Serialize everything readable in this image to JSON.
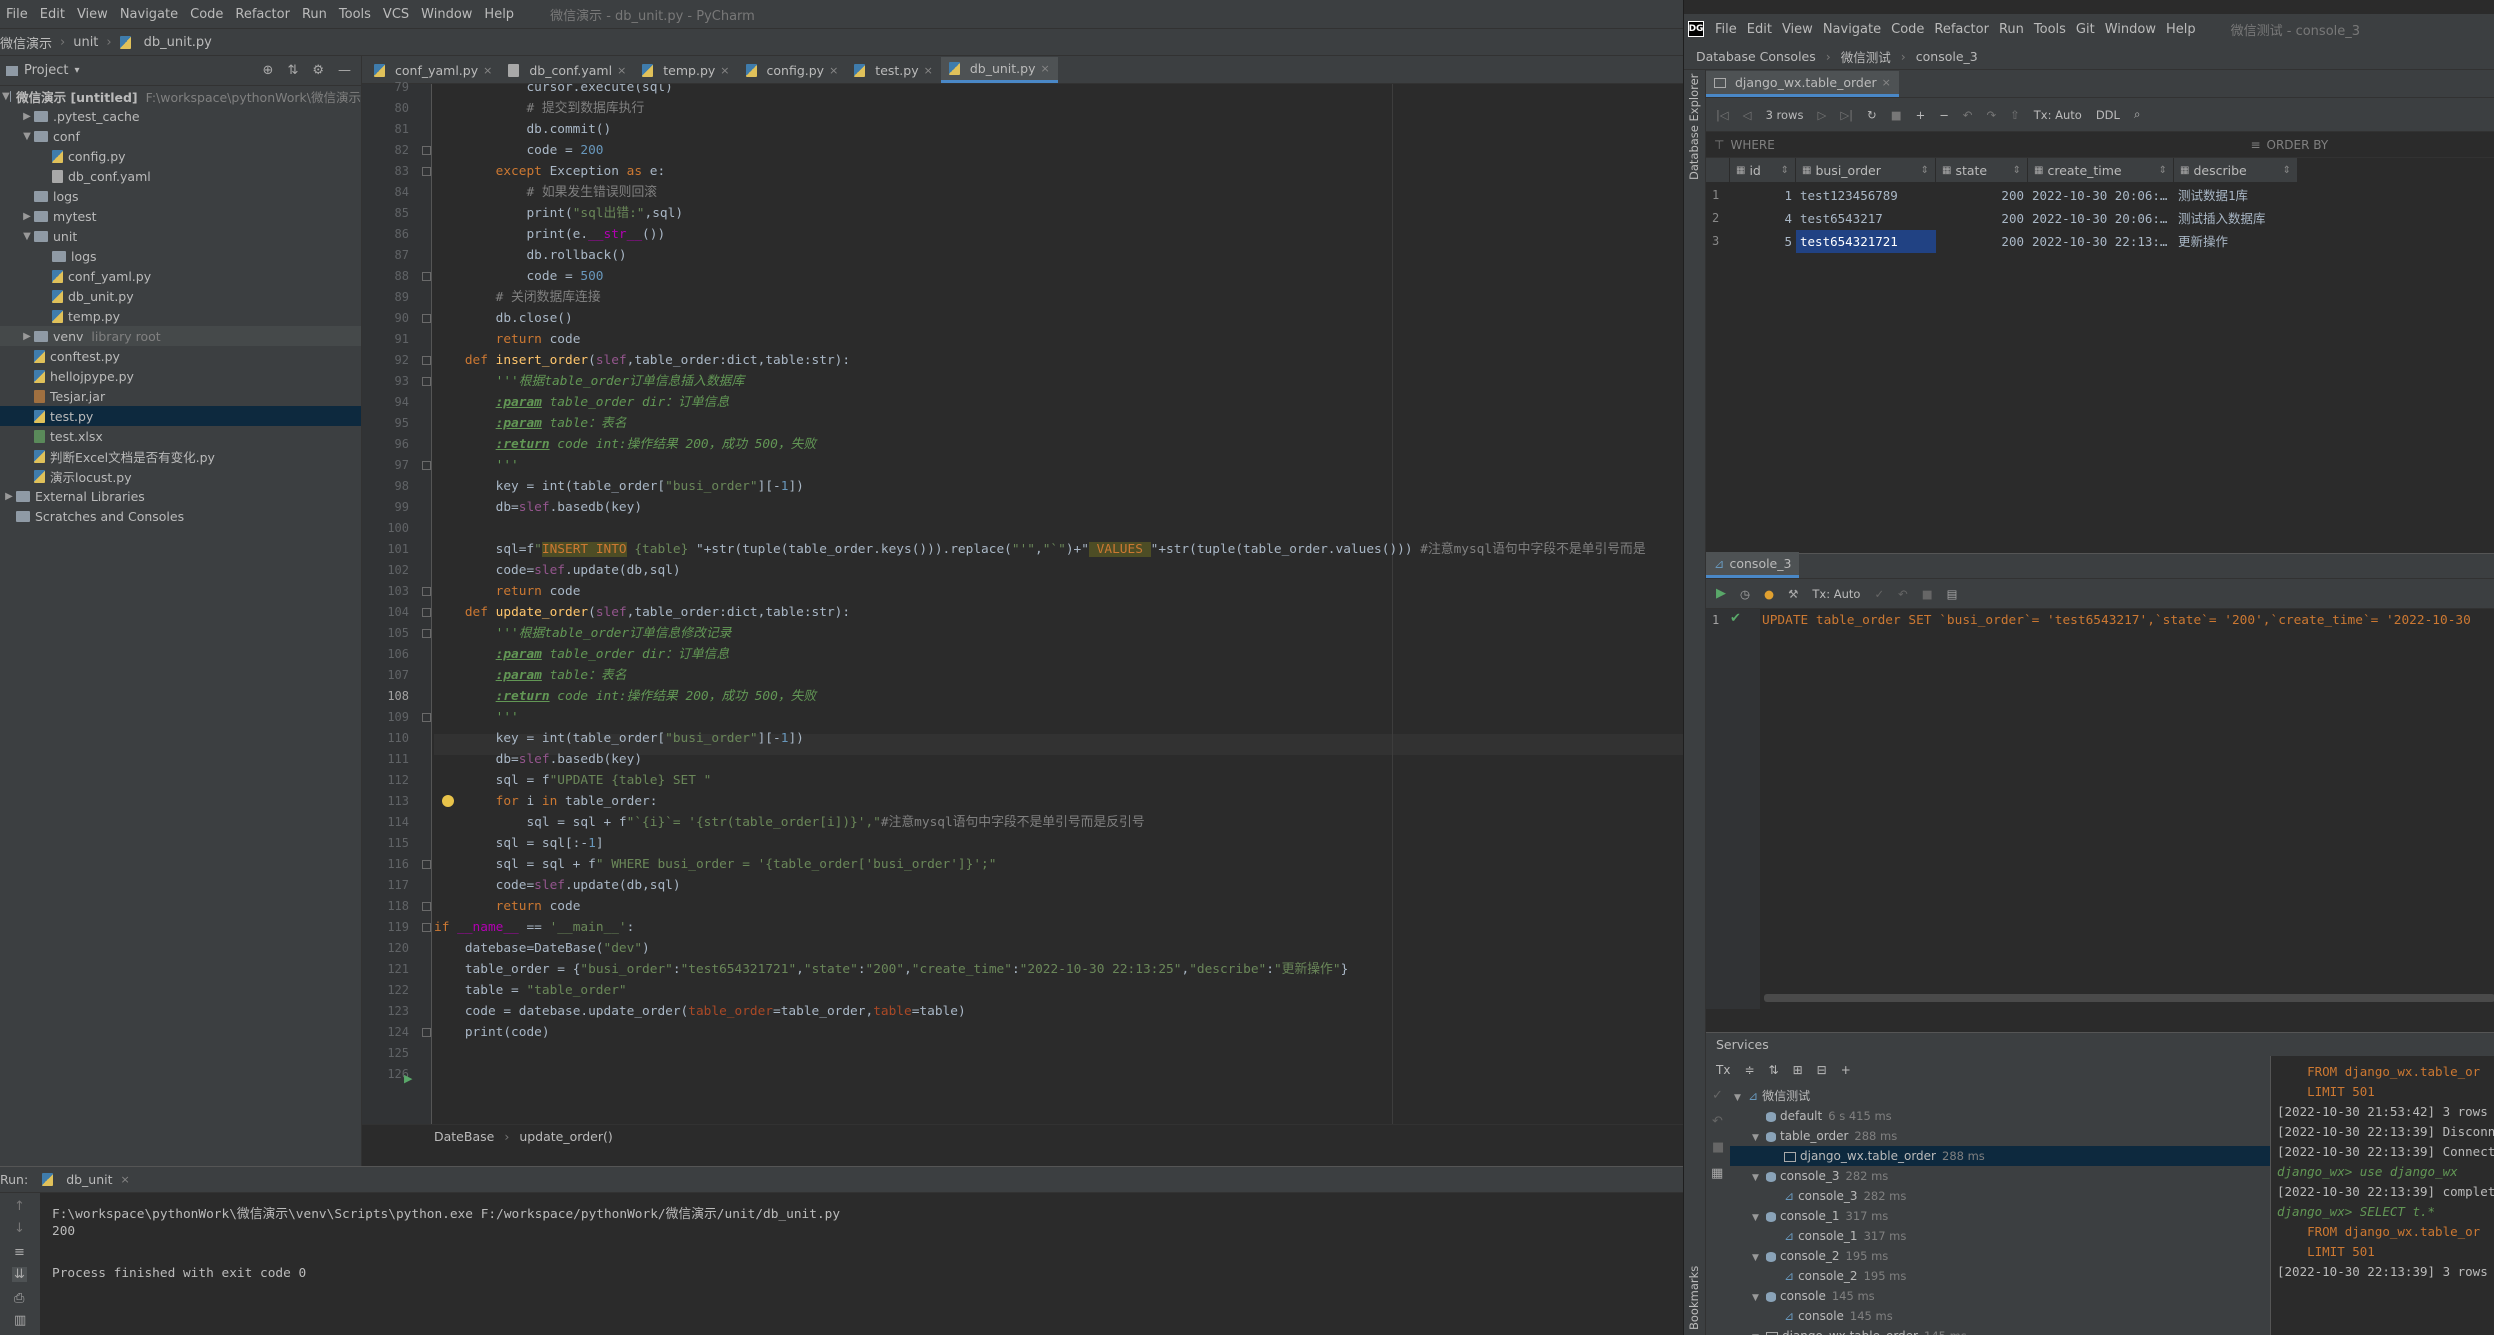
{
  "left": {
    "menu": [
      "File",
      "Edit",
      "View",
      "Navigate",
      "Code",
      "Refactor",
      "Run",
      "Tools",
      "VCS",
      "Window",
      "Help"
    ],
    "window_title": "微信演示 - db_unit.py - PyCharm",
    "breadcrumb": [
      "微信演示",
      "unit",
      "db_unit.py"
    ],
    "project_label": "Project",
    "tree": [
      {
        "name": "微信演示 [untitled]",
        "extra": "F:\\workspace\\pythonWork\\微信演示",
        "type": "root",
        "depth": 0,
        "arrow": "▼"
      },
      {
        "name": ".pytest_cache",
        "type": "folder",
        "depth": 1,
        "arrow": "▶"
      },
      {
        "name": "conf",
        "type": "folder",
        "depth": 1,
        "arrow": "▼"
      },
      {
        "name": "config.py",
        "type": "py",
        "depth": 2,
        "arrow": ""
      },
      {
        "name": "db_conf.yaml",
        "type": "yaml",
        "depth": 2,
        "arrow": ""
      },
      {
        "name": "logs",
        "type": "folder",
        "depth": 1,
        "arrow": ""
      },
      {
        "name": "mytest",
        "type": "folder",
        "depth": 1,
        "arrow": "▶"
      },
      {
        "name": "unit",
        "type": "folder",
        "depth": 1,
        "arrow": "▼"
      },
      {
        "name": "logs",
        "type": "folder",
        "depth": 2,
        "arrow": ""
      },
      {
        "name": "conf_yaml.py",
        "type": "py",
        "depth": 2,
        "arrow": ""
      },
      {
        "name": "db_unit.py",
        "type": "py",
        "depth": 2,
        "arrow": ""
      },
      {
        "name": "temp.py",
        "type": "py",
        "depth": 2,
        "arrow": ""
      },
      {
        "name": "venv",
        "extra": "library root",
        "type": "folder",
        "depth": 1,
        "arrow": "▶",
        "hl": true
      },
      {
        "name": "conftest.py",
        "type": "py",
        "depth": 1,
        "arrow": ""
      },
      {
        "name": "hellojpype.py",
        "type": "py",
        "depth": 1,
        "arrow": ""
      },
      {
        "name": "Tesjar.jar",
        "type": "jar",
        "depth": 1,
        "arrow": ""
      },
      {
        "name": "test.py",
        "type": "py",
        "depth": 1,
        "arrow": "",
        "sel": true
      },
      {
        "name": "test.xlsx",
        "type": "xlsx",
        "depth": 1,
        "arrow": ""
      },
      {
        "name": "判断Excel文档是否有变化.py",
        "type": "py",
        "depth": 1,
        "arrow": ""
      },
      {
        "name": "演示locust.py",
        "type": "py",
        "depth": 1,
        "arrow": ""
      },
      {
        "name": "External Libraries",
        "type": "folder",
        "depth": 0,
        "arrow": "▶"
      },
      {
        "name": "Scratches and Consoles",
        "type": "folder",
        "depth": 0,
        "arrow": ""
      }
    ],
    "tabs": [
      "conf_yaml.py",
      "db_conf.yaml",
      "temp.py",
      "config.py",
      "test.py",
      "db_unit.py"
    ],
    "active_tab": "db_unit.py",
    "first_line": 79,
    "code_crumb": [
      "DateBase",
      "update_order()"
    ],
    "run_tab": "db_unit",
    "run_label": "Run:",
    "run_output": [
      "F:\\workspace\\pythonWork\\微信演示\\venv\\Scripts\\python.exe F:/workspace/pythonWork/微信演示/unit/db_unit.py",
      "200",
      "",
      "Process finished with exit code 0"
    ]
  },
  "right": {
    "menu": [
      "File",
      "Edit",
      "View",
      "Navigate",
      "Code",
      "Refactor",
      "Run",
      "Tools",
      "Git",
      "Window",
      "Help"
    ],
    "window_title": "微信测试 - console_3",
    "nav": [
      "Database Consoles",
      "微信测试",
      "console_3"
    ],
    "side_label": "Database Explorer",
    "bookmarks_label": "Bookmarks",
    "table_tab": "django_wx.table_order",
    "rows_label": "3 rows",
    "tx_label": "Tx: Auto",
    "ddl_label": "DDL",
    "where_label": "WHERE",
    "orderby_label": "ORDER BY",
    "columns": [
      "id",
      "busi_order",
      "state",
      "create_time",
      "describe"
    ],
    "rows": [
      {
        "n": "1",
        "id": "1",
        "busi_order": "test123456789",
        "state": "200",
        "create_time": "2022-10-30 20:06:…",
        "describe": "测试数据1库"
      },
      {
        "n": "2",
        "id": "4",
        "busi_order": "test6543217",
        "state": "200",
        "create_time": "2022-10-30 20:06:…",
        "describe": "测试插入数据库"
      },
      {
        "n": "3",
        "id": "5",
        "busi_order": "test654321721",
        "state": "200",
        "create_time": "2022-10-30 22:13:…",
        "describe": "更新操作"
      }
    ],
    "console_tab": "console_3",
    "console_line_no": "1",
    "console_sql": "UPDATE table_order SET `busi_order`= 'test6543217',`state`= '200',`create_time`= '2022-10-30",
    "services_label": "Services",
    "tx_short": "Tx",
    "services": [
      {
        "name": "微信测试",
        "ms": "",
        "depth": 0,
        "kind": "ds",
        "arrow": "▼"
      },
      {
        "name": "default",
        "ms": "6 s 415 ms",
        "depth": 1,
        "kind": "db",
        "arrow": ""
      },
      {
        "name": "table_order",
        "ms": "288 ms",
        "depth": 1,
        "kind": "db",
        "arrow": "▼"
      },
      {
        "name": "django_wx.table_order",
        "ms": "288 ms",
        "depth": 2,
        "kind": "tbl",
        "arrow": "",
        "sel": true
      },
      {
        "name": "console_3",
        "ms": "282 ms",
        "depth": 1,
        "kind": "db",
        "arrow": "▼"
      },
      {
        "name": "console_3",
        "ms": "282 ms",
        "depth": 2,
        "kind": "con",
        "arrow": ""
      },
      {
        "name": "console_1",
        "ms": "317 ms",
        "depth": 1,
        "kind": "db",
        "arrow": "▼"
      },
      {
        "name": "console_1",
        "ms": "317 ms",
        "depth": 2,
        "kind": "con",
        "arrow": ""
      },
      {
        "name": "console_2",
        "ms": "195 ms",
        "depth": 1,
        "kind": "db",
        "arrow": "▼"
      },
      {
        "name": "console_2",
        "ms": "195 ms",
        "depth": 2,
        "kind": "con",
        "arrow": ""
      },
      {
        "name": "console",
        "ms": "145 ms",
        "depth": 1,
        "kind": "db",
        "arrow": "▼"
      },
      {
        "name": "console",
        "ms": "145 ms",
        "depth": 2,
        "kind": "con",
        "arrow": ""
      },
      {
        "name": "django_wx.table_order",
        "ms": "145 ms",
        "depth": 1,
        "kind": "tbl",
        "arrow": "▼"
      }
    ],
    "log": [
      {
        "t": "    FROM django_wx.table_or",
        "k": "k"
      },
      {
        "t": "    LIMIT 501",
        "k": "k"
      },
      {
        "t": "[2022-10-30 21:53:42] 3 rows retr",
        "k": ""
      },
      {
        "t": "[2022-10-30 22:13:39] Disconnecte",
        "k": ""
      },
      {
        "t": "[2022-10-30 22:13:39] Connected",
        "k": ""
      },
      {
        "t": "django_wx> use django_wx",
        "k": "g"
      },
      {
        "t": "[2022-10-30 22:13:39] completed i",
        "k": ""
      },
      {
        "t": "django_wx> SELECT t.*",
        "k": "g"
      },
      {
        "t": "    FROM django_wx.table_or",
        "k": "k"
      },
      {
        "t": "    LIMIT 501",
        "k": "k"
      },
      {
        "t": "[2022-10-30 22:13:39] 3 rows retr",
        "k": ""
      }
    ]
  }
}
